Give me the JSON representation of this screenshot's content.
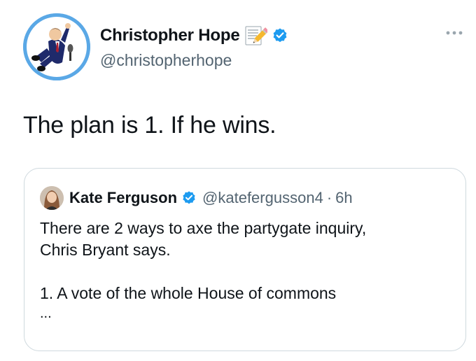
{
  "author": {
    "display_name": "Christopher Hope",
    "handle": "@christopherhope",
    "name_emoji": "memo-emoji",
    "verified": true,
    "avatar": "cartoon-avatar"
  },
  "tweet": {
    "text": "The plan is 1. If he wins."
  },
  "quoted": {
    "display_name": "Kate Ferguson",
    "handle": "@katefergusson4",
    "separator": "·",
    "time": "6h",
    "verified": true,
    "text_lines": [
      "There are 2 ways to axe the partygate inquiry,",
      "Chris Bryant says.",
      "1. A vote of the whole House of commons"
    ],
    "truncation": "..."
  },
  "icons": {
    "more": "more-horizontal-icon",
    "verified": "verified-badge-icon"
  },
  "colors": {
    "text_primary": "#0f1419",
    "text_secondary": "#536471",
    "verified_blue": "#1d9bf0",
    "border": "#cfd9de",
    "avatar_bg": "#5aa8e6"
  }
}
